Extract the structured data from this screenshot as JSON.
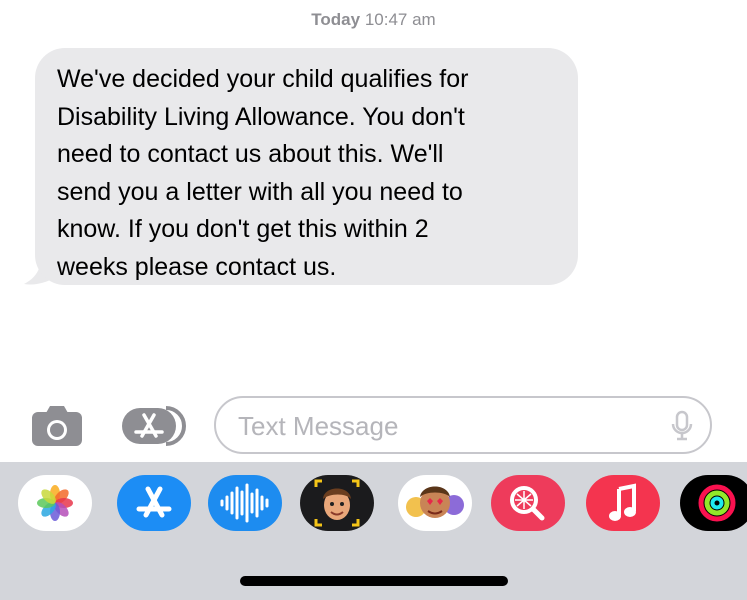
{
  "header": {
    "day": "Today",
    "time": "10:47 am"
  },
  "message": {
    "text": "We've decided your child qualifies for\nDisability Living Allowance. You don't\nneed to contact us about this. We'll\nsend you a letter with all you need to\nknow. If you don't get this within 2\nweeks please contact us.",
    "bubble_color": "#e9e9eb"
  },
  "composer": {
    "placeholder": "Text Message",
    "camera_icon": "camera-icon",
    "apps_icon": "app-store-icon",
    "mic_icon": "microphone-icon"
  },
  "app_drawer": {
    "background": "#d3d5da",
    "apps": [
      "photos-app-icon",
      "app-store-app-icon",
      "audio-message-app-icon",
      "memoji-app-icon",
      "animoji-stickers-app-icon",
      "image-search-app-icon",
      "music-app-icon",
      "fitness-activity-app-icon"
    ]
  }
}
